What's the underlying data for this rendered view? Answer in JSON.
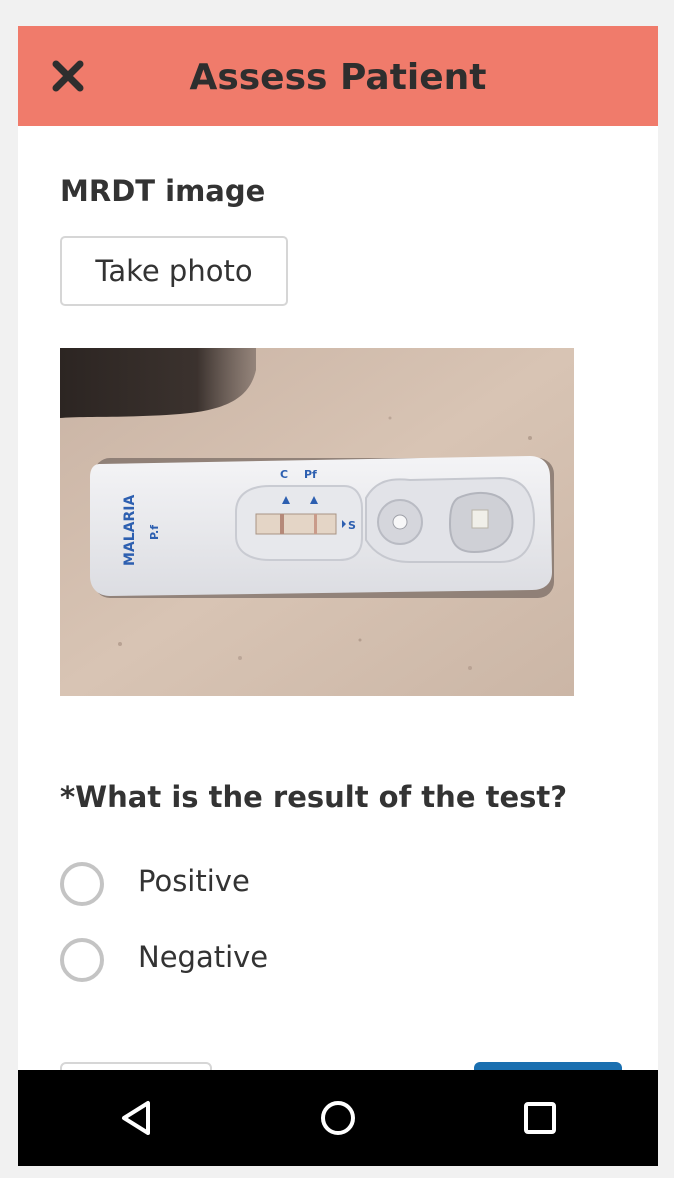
{
  "header": {
    "title": "Assess Patient",
    "color": "#f07b6b",
    "close_icon": "close-icon"
  },
  "mrdt": {
    "label": "MRDT image",
    "button_label": "Take photo",
    "photo": {
      "device_label": "MALARIA",
      "device_sublabel": "P.f",
      "control_marker": "C",
      "test_marker": "Pf",
      "sample_marker": "S"
    }
  },
  "question": {
    "label": "*What is the result of the test?",
    "options": [
      {
        "label": "Positive",
        "selected": false
      },
      {
        "label": "Negative",
        "selected": false
      }
    ]
  },
  "navbar": {
    "back_icon": "back-triangle-icon",
    "home_icon": "home-circle-icon",
    "recents_icon": "recents-square-icon"
  }
}
